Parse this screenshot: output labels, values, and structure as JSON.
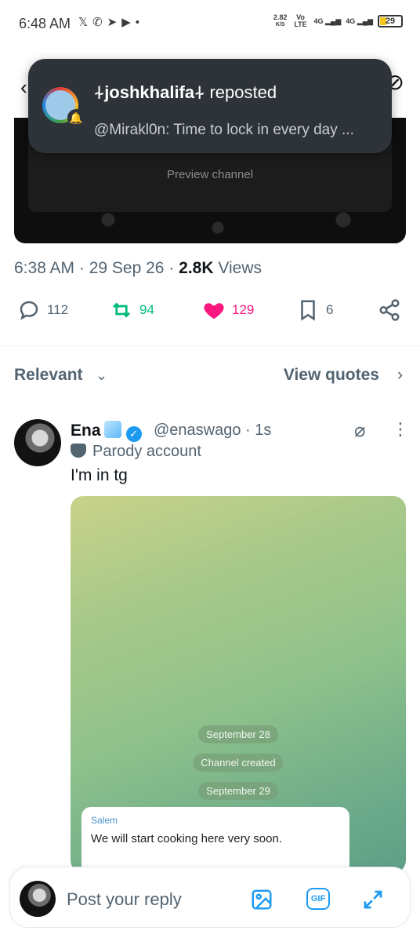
{
  "status_bar": {
    "time": "6:48 AM",
    "app_icons": [
      "x-icon",
      "whatsapp-icon",
      "telegram-icon",
      "youtube-icon",
      "dot-icon"
    ],
    "net_speed": "2.82",
    "net_unit": "K/S",
    "vo_lte": "Vo LTE",
    "signal_1": "4G",
    "signal_2": "4G",
    "battery": "29"
  },
  "notification": {
    "user": "⍭joshkhalifa⍭",
    "action": "reposted",
    "body": "@Mirakl0n: Time to lock in every day ..."
  },
  "embedded_media": {
    "preview_label": "Preview channel"
  },
  "tweet_meta": {
    "time": "6:38 AM",
    "date": "29 Sep 26",
    "views_count": "2.8K",
    "views_label": "Views"
  },
  "actions": {
    "replies": "112",
    "reposts": "94",
    "likes": "129",
    "bookmarks": "6"
  },
  "sort": {
    "label": "Relevant",
    "view_quotes": "View quotes"
  },
  "reply": {
    "name": "Ena",
    "handle": "@enaswago · 1s",
    "parody_label": "Parody account",
    "text": "I'm in tg"
  },
  "tg_screenshot": {
    "date_1": "September 28",
    "created": "Channel created",
    "date_2": "September 29",
    "sender": "Salem",
    "message": "We will start cooking here very soon."
  },
  "reply_bar": {
    "placeholder": "Post your reply",
    "gif_label": "GIF"
  },
  "colors": {
    "accent": "#1d9bf0",
    "retweet": "#00ba7c",
    "like": "#f91880",
    "muted": "#536471"
  }
}
